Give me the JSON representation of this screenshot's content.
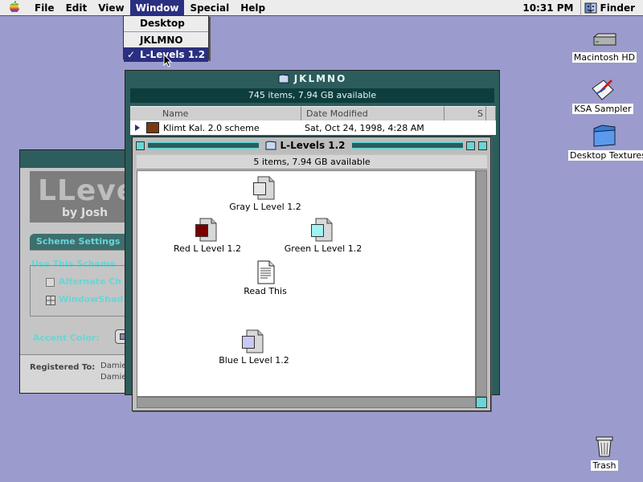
{
  "menubar": {
    "items": [
      "File",
      "Edit",
      "View",
      "Window",
      "Special",
      "Help"
    ],
    "active": "Window",
    "clock": "10:31 PM",
    "app": "Finder"
  },
  "window_menu": {
    "items": [
      {
        "label": "Desktop",
        "checked": false
      },
      {
        "label": "JKLMNO",
        "checked": false
      },
      {
        "label": "L-Levels 1.2",
        "checked": true
      }
    ],
    "check_mark": "✓"
  },
  "desktop_icons": [
    {
      "label": "Macintosh HD",
      "icon": "hard-drive-icon"
    },
    {
      "label": "KSA Sampler",
      "icon": "app-icon"
    },
    {
      "label": "Desktop Textures",
      "icon": "folder-icon"
    },
    {
      "label": "Trash",
      "icon": "trash-icon"
    }
  ],
  "theme_window": {
    "logo_big": "LLeve",
    "logo_sub": "by Josh",
    "tab": "Scheme Settings",
    "group_label": "Use This Scheme",
    "options": [
      "Alternate Ch",
      "WindowShad"
    ],
    "accent_label": "Accent Color:",
    "registered_label": "Registered To:",
    "registered_values": [
      "Damie",
      "Damie"
    ]
  },
  "jklmno_window": {
    "title": "JKLMNO",
    "info": "745 items, 7.94 GB available",
    "columns": [
      "Name",
      "Date Modified",
      "S"
    ],
    "rows": [
      {
        "name": "Klimt Kal. 2.0 scheme",
        "date": "Sat, Oct 24, 1998, 4:28 AM"
      }
    ]
  },
  "llevels_window": {
    "title": "L-Levels 1.2",
    "info": "5 items, 7.94 GB available",
    "files": [
      {
        "label": "Gray L Level 1.2",
        "swatch": "#e6e6e6"
      },
      {
        "label": "Red L Level 1.2",
        "swatch": "#7a0000"
      },
      {
        "label": "Green L Level 1.2",
        "swatch": "#9ef3f3"
      },
      {
        "label": "Read This",
        "swatch": ""
      },
      {
        "label": "Blue L Level 1.2",
        "swatch": "#c9c9f5"
      }
    ]
  },
  "colors": {
    "desktop": "#9b9bcd",
    "menu_highlight": "#2b2f80",
    "window_teal": "#2c5c5c",
    "accent_cyan": "#6ad5d5"
  }
}
